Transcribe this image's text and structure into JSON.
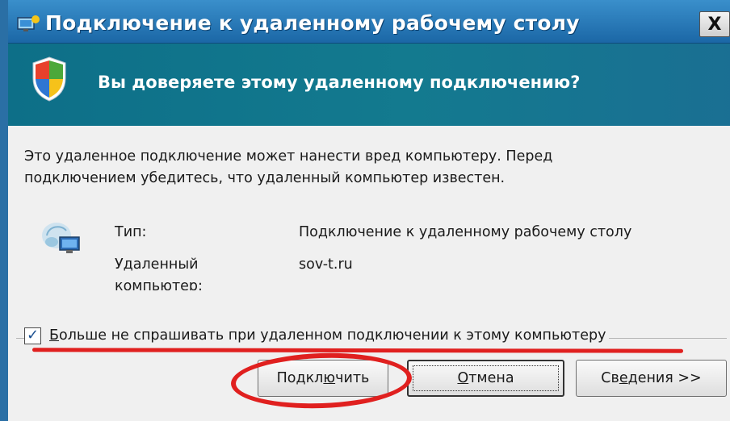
{
  "window": {
    "title": "Подключение к удаленному рабочему столу",
    "close_label": "X"
  },
  "banner": {
    "question": "Вы доверяете этому удаленному подключению?"
  },
  "body": {
    "description_line1": "Это удаленное подключение может нанести вред компьютеру. Перед",
    "description_line2": "подключением убедитесь, что удаленный компьютер известен.",
    "type_label": "Тип:",
    "type_value": "Подключение к удаленному рабочему столу",
    "remote_label_line1": "Удаленный",
    "remote_label_line2": "компьютер:",
    "remote_value": "sov-t.ru"
  },
  "checkbox": {
    "checked": true,
    "mark": "✓",
    "label_underlined": "Б",
    "label_rest": "ольше не спрашивать при удаленном подключении к этому компьютеру"
  },
  "buttons": {
    "connect_pre": "Подкл",
    "connect_underlined": "ю",
    "connect_post": "чить",
    "cancel_underlined": "О",
    "cancel_rest": "тмена",
    "details_pre": "Св",
    "details_underlined": "е",
    "details_post": "дения >>"
  },
  "colors": {
    "titlebar": "#1b67a6",
    "banner": "#0d6f88",
    "annotation_red": "#e0201f"
  },
  "icons": {
    "title": "remote-desktop-icon",
    "banner": "security-shield-icon",
    "connection": "remote-computer-icon"
  }
}
